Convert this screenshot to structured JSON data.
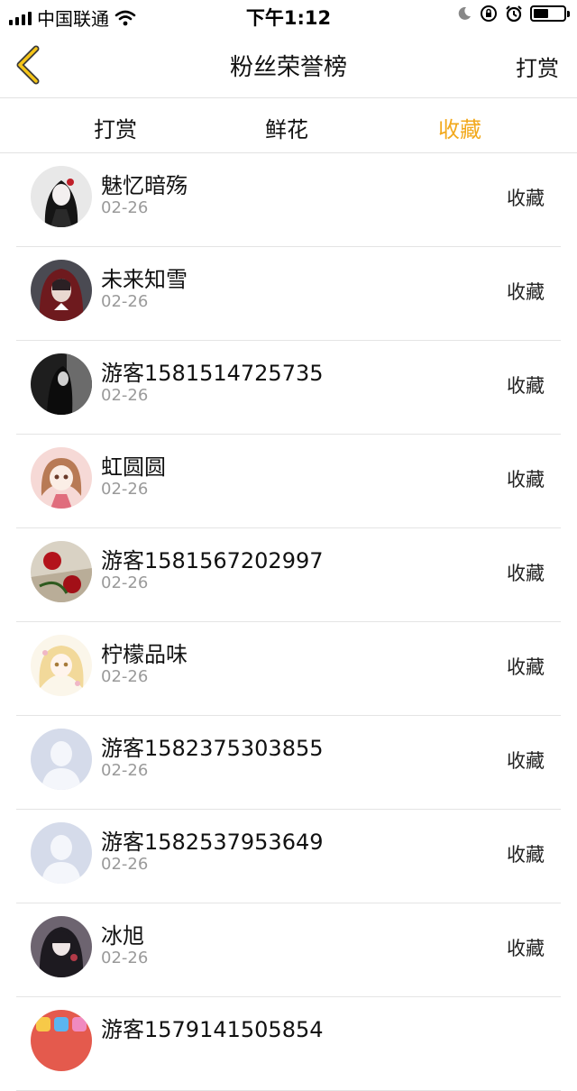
{
  "status_bar": {
    "carrier": "中国联通",
    "time": "下午1:12"
  },
  "navbar": {
    "title": "粉丝荣誉榜",
    "right_action": "打赏"
  },
  "tabs": [
    {
      "label": "打赏",
      "active": false
    },
    {
      "label": "鲜花",
      "active": false
    },
    {
      "label": "收藏",
      "active": true
    }
  ],
  "accent_color": "#f2a91d",
  "list": [
    {
      "name": "魅忆暗殇",
      "date": "02-26",
      "action": "收藏",
      "avatar": "anime-dark-girl-avatar"
    },
    {
      "name": "未来知雪",
      "date": "02-26",
      "action": "收藏",
      "avatar": "red-hood-avatar"
    },
    {
      "name": "游客1581514725735",
      "date": "02-26",
      "action": "收藏",
      "avatar": "dark-figure-avatar"
    },
    {
      "name": "虹圆圆",
      "date": "02-26",
      "action": "收藏",
      "avatar": "pink-anime-girl-avatar"
    },
    {
      "name": "游客1581567202997",
      "date": "02-26",
      "action": "收藏",
      "avatar": "red-roses-avatar"
    },
    {
      "name": "柠檬品味",
      "date": "02-26",
      "action": "收藏",
      "avatar": "blonde-anime-girl-avatar"
    },
    {
      "name": "游客1582375303855",
      "date": "02-26",
      "action": "收藏",
      "avatar": "default-user-avatar"
    },
    {
      "name": "游客1582537953649",
      "date": "02-26",
      "action": "收藏",
      "avatar": "default-user-avatar"
    },
    {
      "name": "冰旭",
      "date": "02-26",
      "action": "收藏",
      "avatar": "dark-anime-girl-avatar"
    },
    {
      "name": "游客1579141505854",
      "date": "",
      "action": "",
      "avatar": "colorful-icons-avatar"
    }
  ]
}
